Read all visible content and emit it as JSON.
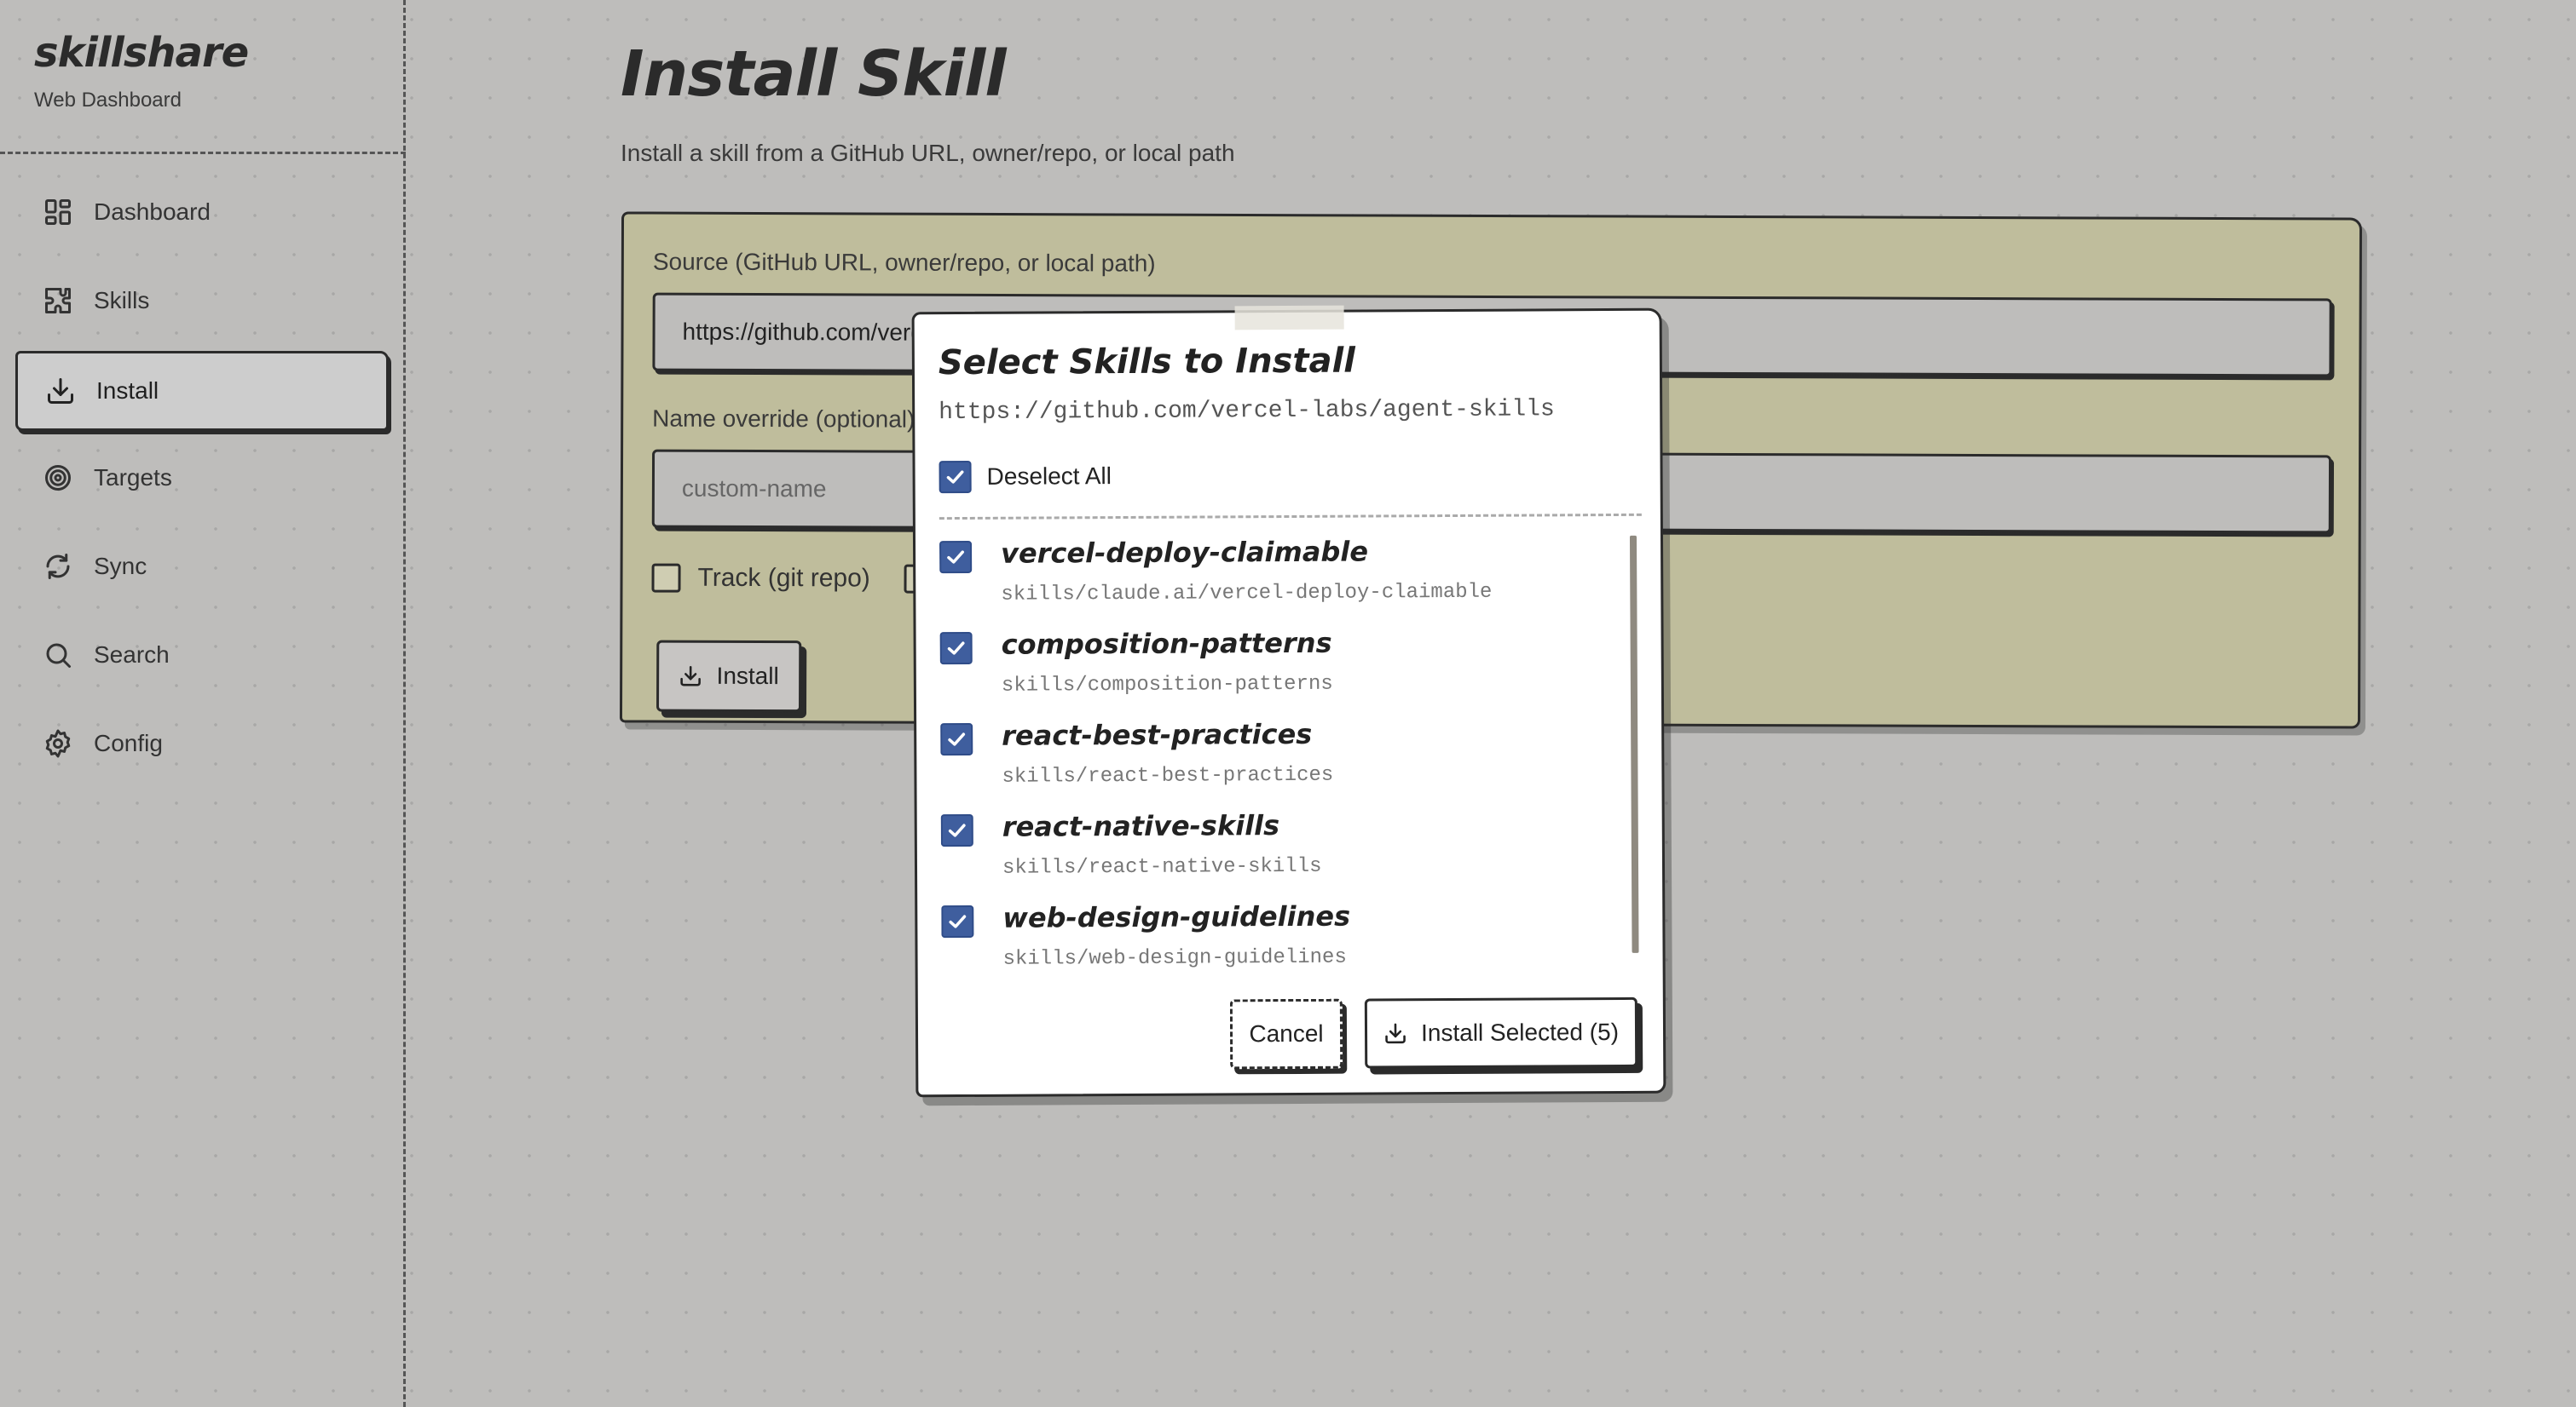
{
  "app": {
    "name": "skillshare",
    "subtitle": "Web Dashboard"
  },
  "sidebar": {
    "items": [
      {
        "label": "Dashboard",
        "icon": "dashboard-icon"
      },
      {
        "label": "Skills",
        "icon": "puzzle-icon"
      },
      {
        "label": "Install",
        "icon": "download-icon",
        "active": true
      },
      {
        "label": "Targets",
        "icon": "target-icon"
      },
      {
        "label": "Sync",
        "icon": "sync-icon"
      },
      {
        "label": "Search",
        "icon": "search-icon"
      },
      {
        "label": "Config",
        "icon": "gear-icon"
      }
    ]
  },
  "page": {
    "title": "Install Skill",
    "subtitle": "Install a skill from a GitHub URL, owner/repo, or local path"
  },
  "form": {
    "source_label": "Source (GitHub URL, owner/repo, or local path)",
    "source_value": "https://github.com/vercel-labs/agent-skills",
    "name_label": "Name override (optional)",
    "name_placeholder": "custom-name",
    "track_label": "Track (git repo)",
    "install_label": "Install"
  },
  "modal": {
    "title": "Select Skills to Install",
    "url": "https://github.com/vercel-labs/agent-skills",
    "toggle_all_label": "Deselect All",
    "skills": [
      {
        "name": "vercel-deploy-claimable",
        "path": "skills/claude.ai/vercel-deploy-claimable",
        "checked": true
      },
      {
        "name": "composition-patterns",
        "path": "skills/composition-patterns",
        "checked": true
      },
      {
        "name": "react-best-practices",
        "path": "skills/react-best-practices",
        "checked": true
      },
      {
        "name": "react-native-skills",
        "path": "skills/react-native-skills",
        "checked": true
      },
      {
        "name": "web-design-guidelines",
        "path": "skills/web-design-guidelines",
        "checked": true
      }
    ],
    "cancel_label": "Cancel",
    "install_selected_label": "Install Selected (5)"
  },
  "colors": {
    "background": "#bebdbb",
    "card": "#bfbd9c",
    "checkbox": "#3f5e9e",
    "ink": "#2b2b2b"
  }
}
